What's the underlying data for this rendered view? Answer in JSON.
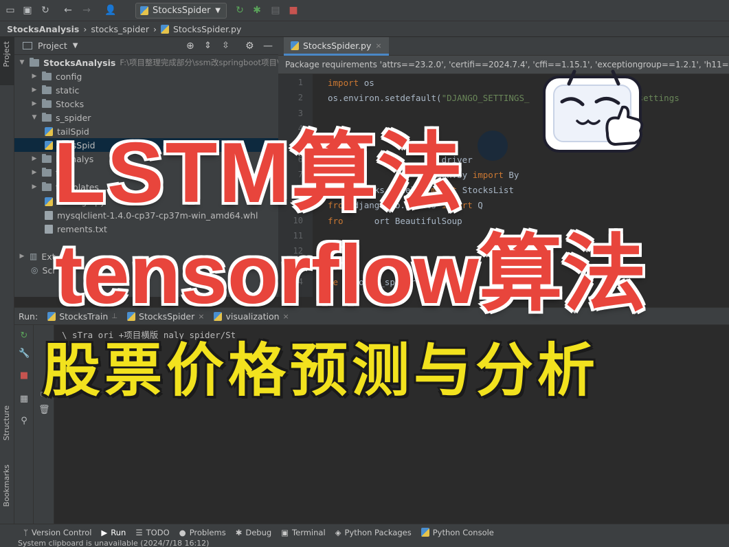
{
  "toolbar": {
    "run_config": "StocksSpider"
  },
  "breadcrumb": [
    "StocksAnalysis",
    "stocks_spider",
    "StocksSpider.py"
  ],
  "left_strip": {
    "project": "Project",
    "structure": "Structure",
    "bookmarks": "Bookmarks"
  },
  "project_panel": {
    "title": "Project",
    "root_name": "StocksAnalysis",
    "root_path": "F:\\项目整理完成部分\\ssm改springboot项目\\",
    "items": [
      {
        "label": "config"
      },
      {
        "label": "static"
      },
      {
        "label": "Stocks"
      },
      {
        "label": "s_spider"
      },
      {
        "label": "tailSpid"
      },
      {
        "label": "ocksSpid"
      },
      {
        "label": "ksAnalys"
      },
      {
        "label": "tes"
      },
      {
        "label": "templates"
      },
      {
        "label": "manage.py"
      },
      {
        "label": "mysqlclient-1.4.0-cp37-cp37m-win_amd64.whl"
      },
      {
        "label": "rements.txt"
      },
      {
        "label": "Ext"
      },
      {
        "label": "Scr"
      }
    ]
  },
  "editor": {
    "tab": "StocksSpider.py",
    "banner": "Package requirements 'attrs==23.2.0', 'certifi==2024.7.4', 'cffi==1.15.1', 'exceptiongroup==1.2.1', 'h11==0.14",
    "lines": [
      {
        "n": "1",
        "segments": [
          {
            "t": "import ",
            "c": "kw"
          },
          {
            "t": "os",
            "c": ""
          }
        ]
      },
      {
        "n": "2",
        "segments": [
          {
            "t": "os.environ.setdefault(",
            "c": ""
          },
          {
            "t": "\"DJANGO_SETTINGS_",
            "c": "str"
          },
          {
            "t": "              ",
            "c": ""
          },
          {
            "t": "alysis.settings",
            "c": "str"
          }
        ]
      },
      {
        "n": "3",
        "segments": []
      },
      {
        "n": "4",
        "segments": []
      },
      {
        "n": "5",
        "segments": []
      },
      {
        "n": "6",
        "segments": [
          {
            "t": "                      driver",
            "c": ""
          }
        ]
      },
      {
        "n": "7",
        "segments": [
          {
            "t": "                  common.by ",
            "c": ""
          },
          {
            "t": "import ",
            "c": "kw"
          },
          {
            "t": "By",
            "c": ""
          }
        ]
      },
      {
        "n": "8",
        "segments": [
          {
            "t": "from ",
            "c": "kw"
          },
          {
            "t": "Stocks.models ",
            "c": ""
          },
          {
            "t": "import ",
            "c": "kw"
          },
          {
            "t": "StocksList",
            "c": ""
          }
        ]
      },
      {
        "n": "9",
        "segments": [
          {
            "t": "from ",
            "c": "kw"
          },
          {
            "t": "django.db.models ",
            "c": ""
          },
          {
            "t": "import ",
            "c": "kw"
          },
          {
            "t": "Q",
            "c": ""
          }
        ]
      },
      {
        "n": "10",
        "segments": [
          {
            "t": "fro",
            "c": "kw"
          },
          {
            "t": "      ort BeautifulSoup",
            "c": ""
          }
        ]
      },
      {
        "n": "11",
        "segments": []
      },
      {
        "n": "12",
        "segments": []
      },
      {
        "n": "13",
        "segments": []
      },
      {
        "n": "14",
        "segments": [
          {
            "t": "de",
            "c": "kw"
          },
          {
            "t": "  stocks_spider():",
            "c": ""
          }
        ]
      }
    ]
  },
  "run_panel": {
    "label": "Run:",
    "tabs": [
      {
        "label": "StocksTrain"
      },
      {
        "label": "StocksSpider"
      },
      {
        "label": "visualization"
      }
    ],
    "output": "\\     sTra            ori     +项目横版       naly       spider/St"
  },
  "bottom_bar": [
    {
      "label": "Version Control",
      "icon": "branch-icon"
    },
    {
      "label": "Run",
      "icon": "play-icon"
    },
    {
      "label": "TODO",
      "icon": "list-icon"
    },
    {
      "label": "Problems",
      "icon": "info-icon"
    },
    {
      "label": "Debug",
      "icon": "bug-icon"
    },
    {
      "label": "Terminal",
      "icon": "terminal-icon"
    },
    {
      "label": "Python Packages",
      "icon": "layers-icon"
    },
    {
      "label": "Python Console",
      "icon": "python-icon"
    }
  ],
  "status": "System clipboard is unavailable (2024/7/18 16:12)",
  "overlay": {
    "line1": "LSTM算法",
    "line2": "tensorflow算法",
    "line3": "股票价格预测与分析"
  },
  "colors": {
    "overlay_red": "#e8453c",
    "overlay_yellow": "#f2e21e",
    "ide_bg": "#2b2b2b",
    "panel_bg": "#3c3f41",
    "accent_blue": "#4a88c7"
  }
}
